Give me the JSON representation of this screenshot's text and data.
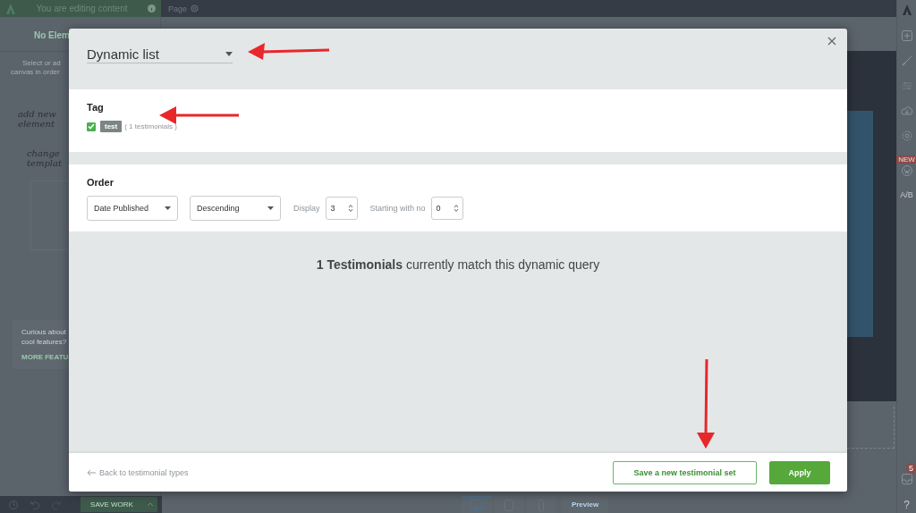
{
  "top_bar": {
    "editing_label": "You are editing content",
    "page_tab": "Page"
  },
  "left_panel": {
    "title": "No Elem",
    "hint_lines": [
      "Select or ad",
      "canvas in order"
    ],
    "handwritten": [
      "add new",
      "element",
      "change",
      "templat"
    ],
    "promo": {
      "lines": [
        "Curious about",
        "cool features?"
      ],
      "link": "MORE FEATU"
    }
  },
  "right_sidebar": {
    "new_badge": "NEW",
    "ab_label": "A/B",
    "notification_count": "5",
    "help": "?"
  },
  "bottom_bar": {
    "save_button": "SAVE WORK",
    "preview": "Preview",
    "devices": [
      {
        "kind": "desktop",
        "selected": true
      },
      {
        "kind": "tablet",
        "selected": false
      },
      {
        "kind": "phone",
        "selected": false
      }
    ]
  },
  "modal": {
    "list_type": "Dynamic list",
    "tag_section": {
      "title": "Tag",
      "tags": [
        {
          "label": "test",
          "count": "( 1 testimonials )",
          "checked": true
        }
      ]
    },
    "order_section": {
      "title": "Order",
      "sort_field": "Date Published",
      "sort_direction": "Descending",
      "display_label": "Display",
      "display_value": "3",
      "start_label": "Starting with no",
      "start_value": "0"
    },
    "match_text": "**1 Testimonials** currently match this dynamic query",
    "back_link": "Back to testimonial types",
    "buttons": [
      {
        "label": "Save a new testimonial set",
        "kind": "secondary"
      },
      {
        "label": "Apply",
        "kind": "primary"
      }
    ]
  }
}
